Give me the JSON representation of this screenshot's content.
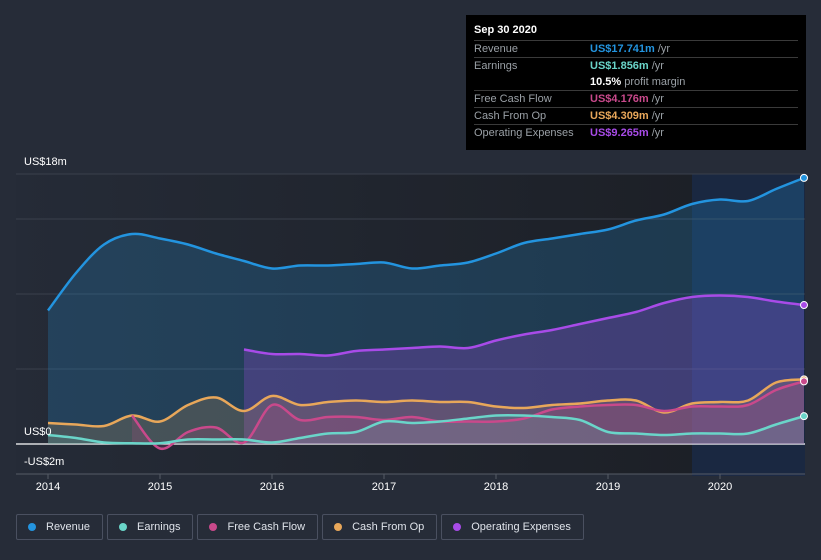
{
  "tooltip": {
    "date": "Sep 30 2020",
    "rows": [
      {
        "label": "Revenue",
        "value": "US$17.741m",
        "unit": "/yr",
        "color": "#2394df"
      },
      {
        "label": "Earnings",
        "value": "US$1.856m",
        "unit": "/yr",
        "color": "#6ad5c9"
      },
      {
        "label": "",
        "value": "10.5%",
        "unit": "profit margin",
        "color": "#ffffff"
      },
      {
        "label": "Free Cash Flow",
        "value": "US$4.176m",
        "unit": "/yr",
        "color": "#c9498b"
      },
      {
        "label": "Cash From Op",
        "value": "US$4.309m",
        "unit": "/yr",
        "color": "#e8a75a"
      },
      {
        "label": "Operating Expenses",
        "value": "US$9.265m",
        "unit": "/yr",
        "color": "#a84be8"
      }
    ]
  },
  "legend": [
    {
      "label": "Revenue",
      "color": "#2394df"
    },
    {
      "label": "Earnings",
      "color": "#6ad5c9"
    },
    {
      "label": "Free Cash Flow",
      "color": "#c9498b"
    },
    {
      "label": "Cash From Op",
      "color": "#e8a75a"
    },
    {
      "label": "Operating Expenses",
      "color": "#a84be8"
    }
  ],
  "chart_data": {
    "type": "area",
    "title": "",
    "xlabel": "",
    "ylabel": "",
    "y_tick_labels": [
      "US$18m",
      "US$0",
      "-US$2m"
    ],
    "ylim": [
      -2,
      18
    ],
    "x_tick_labels": [
      "2014",
      "2015",
      "2016",
      "2017",
      "2018",
      "2019",
      "2020"
    ],
    "xlim": [
      2013.7,
      2020.75
    ],
    "grid": true,
    "legend_position": "bottom",
    "highlight_range": [
      2019.75,
      2020.75
    ],
    "series": [
      {
        "name": "Revenue",
        "color": "#2394df",
        "x": [
          2014.0,
          2014.25,
          2014.5,
          2014.75,
          2015.0,
          2015.25,
          2015.5,
          2015.75,
          2016.0,
          2016.25,
          2016.5,
          2016.75,
          2017.0,
          2017.25,
          2017.5,
          2017.75,
          2018.0,
          2018.25,
          2018.5,
          2018.75,
          2019.0,
          2019.25,
          2019.5,
          2019.75,
          2020.0,
          2020.25,
          2020.5,
          2020.75
        ],
        "values": [
          8.9,
          11.4,
          13.3,
          14.0,
          13.7,
          13.3,
          12.7,
          12.2,
          11.7,
          11.9,
          11.9,
          12.0,
          12.1,
          11.7,
          11.9,
          12.1,
          12.7,
          13.4,
          13.7,
          14.0,
          14.3,
          14.9,
          15.3,
          16.0,
          16.3,
          16.2,
          17.0,
          17.741
        ]
      },
      {
        "name": "Operating Expenses",
        "color": "#a84be8",
        "x": [
          2015.75,
          2016.0,
          2016.25,
          2016.5,
          2016.75,
          2017.0,
          2017.25,
          2017.5,
          2017.75,
          2018.0,
          2018.25,
          2018.5,
          2018.75,
          2019.0,
          2019.25,
          2019.5,
          2019.75,
          2020.0,
          2020.25,
          2020.5,
          2020.75
        ],
        "values": [
          6.3,
          6.0,
          6.0,
          5.9,
          6.2,
          6.3,
          6.4,
          6.5,
          6.4,
          6.9,
          7.3,
          7.6,
          8.0,
          8.4,
          8.8,
          9.4,
          9.8,
          9.9,
          9.8,
          9.5,
          9.265
        ]
      },
      {
        "name": "Cash From Op",
        "color": "#e8a75a",
        "x": [
          2014.0,
          2014.25,
          2014.5,
          2014.75,
          2015.0,
          2015.25,
          2015.5,
          2015.75,
          2016.0,
          2016.25,
          2016.5,
          2016.75,
          2017.0,
          2017.25,
          2017.5,
          2017.75,
          2018.0,
          2018.25,
          2018.5,
          2018.75,
          2019.0,
          2019.25,
          2019.5,
          2019.75,
          2020.0,
          2020.25,
          2020.5,
          2020.75
        ],
        "values": [
          1.4,
          1.3,
          1.2,
          1.9,
          1.5,
          2.6,
          3.1,
          2.2,
          3.2,
          2.6,
          2.8,
          2.9,
          2.8,
          2.9,
          2.8,
          2.8,
          2.5,
          2.4,
          2.6,
          2.7,
          2.9,
          2.9,
          2.1,
          2.7,
          2.8,
          2.9,
          4.1,
          4.309
        ]
      },
      {
        "name": "Free Cash Flow",
        "color": "#c9498b",
        "x": [
          2014.75,
          2015.0,
          2015.25,
          2015.5,
          2015.75,
          2016.0,
          2016.25,
          2016.5,
          2016.75,
          2017.0,
          2017.25,
          2017.5,
          2017.75,
          2018.0,
          2018.25,
          2018.5,
          2018.75,
          2019.0,
          2019.25,
          2019.5,
          2019.75,
          2020.0,
          2020.25,
          2020.5,
          2020.75
        ],
        "values": [
          1.9,
          -0.3,
          0.8,
          1.1,
          0.1,
          2.6,
          1.6,
          1.8,
          1.8,
          1.6,
          1.8,
          1.5,
          1.5,
          1.5,
          1.7,
          2.3,
          2.5,
          2.6,
          2.6,
          2.2,
          2.5,
          2.5,
          2.6,
          3.6,
          4.176
        ]
      },
      {
        "name": "Earnings",
        "color": "#6ad5c9",
        "x": [
          2014.0,
          2014.25,
          2014.5,
          2014.75,
          2015.0,
          2015.25,
          2015.5,
          2015.75,
          2016.0,
          2016.25,
          2016.5,
          2016.75,
          2017.0,
          2017.25,
          2017.5,
          2017.75,
          2018.0,
          2018.25,
          2018.5,
          2018.75,
          2019.0,
          2019.25,
          2019.5,
          2019.75,
          2020.0,
          2020.25,
          2020.5,
          2020.75
        ],
        "values": [
          0.6,
          0.4,
          0.1,
          0.05,
          0.05,
          0.3,
          0.3,
          0.3,
          0.1,
          0.4,
          0.7,
          0.8,
          1.5,
          1.4,
          1.5,
          1.7,
          1.9,
          1.9,
          1.8,
          1.6,
          0.8,
          0.7,
          0.6,
          0.7,
          0.7,
          0.7,
          1.3,
          1.856
        ]
      }
    ]
  }
}
